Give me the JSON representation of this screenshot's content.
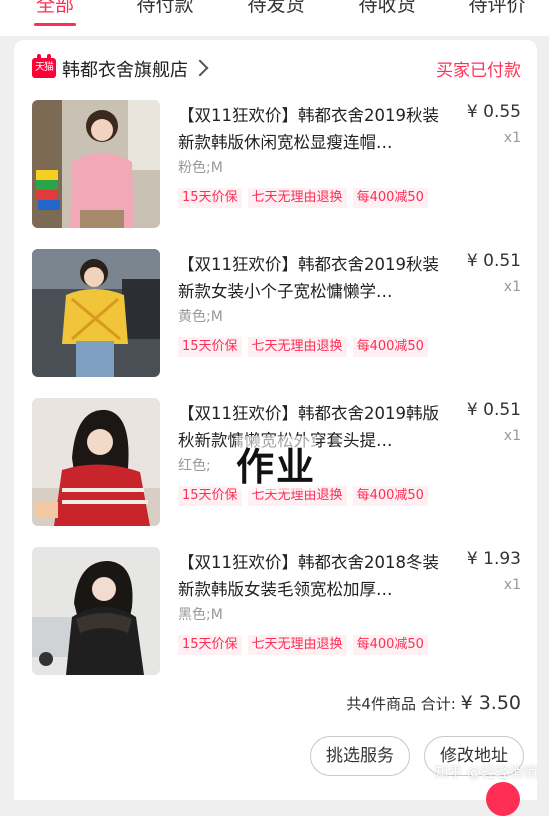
{
  "tabs": [
    "全部",
    "待付款",
    "待发货",
    "待收货",
    "待评价"
  ],
  "shop": {
    "badge": "天猫",
    "name": "韩都衣舍旗舰店",
    "status": "买家已付款"
  },
  "items": [
    {
      "title": "【双11狂欢价】韩都衣舍2019秋装新款韩版休闲宽松显瘦连帽…",
      "spec": "粉色;M",
      "price": "¥ 0.55",
      "qty": "x1",
      "tags": [
        "15天价保",
        "七天无理由退换",
        "每400减50"
      ]
    },
    {
      "title": "【双11狂欢价】韩都衣舍2019秋装新款女装小个子宽松慵懒学…",
      "spec": "黄色;M",
      "price": "¥ 0.51",
      "qty": "x1",
      "tags": [
        "15天价保",
        "七天无理由退换",
        "每400减50"
      ]
    },
    {
      "title": "【双11狂欢价】韩都衣舍2019韩版秋新款慵懒宽松外穿套头提…",
      "spec": "红色;",
      "price": "¥ 0.51",
      "qty": "x1",
      "tags": [
        "15天价保",
        "七天无理由退换",
        "每400减50"
      ]
    },
    {
      "title": "【双11狂欢价】韩都衣舍2018冬装新款韩版女装毛领宽松加厚…",
      "spec": "黑色;M",
      "price": "¥ 1.93",
      "qty": "x1",
      "tags": [
        "15天价保",
        "七天无理由退换",
        "每400减50"
      ]
    }
  ],
  "summary": {
    "count_text": "共4件商品 合计:",
    "total": "¥ 3.50"
  },
  "buttons": {
    "service": "挑选服务",
    "address": "修改地址"
  },
  "watermarks": {
    "overlay": "作业",
    "credit": "知乎 @轻轻悄悄"
  },
  "colors": {
    "accent": "#ff2e55",
    "tag_bg": "#fff0f3"
  }
}
